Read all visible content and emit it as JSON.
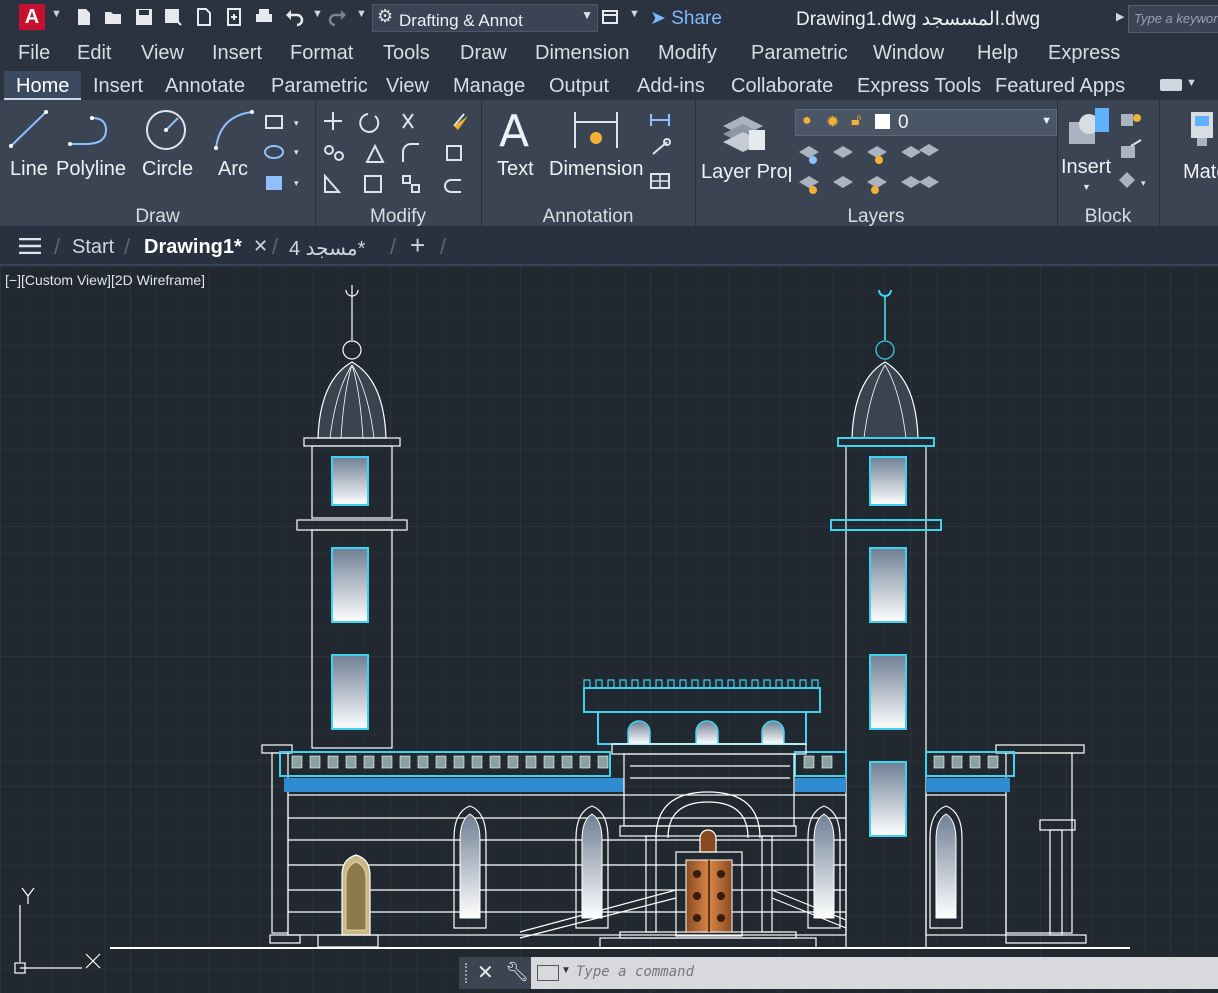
{
  "app": {
    "logo_letter": "A",
    "workspace": "Drafting & Annot",
    "share_label": "Share",
    "title": "Drawing1.dwg المسسجد.dwg",
    "search_placeholder": "Type a keyword"
  },
  "menu": [
    "File",
    "Edit",
    "View",
    "Insert",
    "Format",
    "Tools",
    "Draw",
    "Dimension",
    "Modify",
    "Parametric",
    "Window",
    "Help",
    "Express"
  ],
  "ribbon_tabs": [
    "Home",
    "Insert",
    "Annotate",
    "Parametric",
    "View",
    "Manage",
    "Output",
    "Add-ins",
    "Collaborate",
    "Express Tools",
    "Featured Apps"
  ],
  "ribbon": {
    "draw": {
      "title": "Draw",
      "line": "Line",
      "polyline": "Polyline",
      "circle": "Circle",
      "arc": "Arc"
    },
    "modify": {
      "title": "Modify"
    },
    "annotation": {
      "title": "Annotation",
      "text": "Text",
      "dimension": "Dimension"
    },
    "layers": {
      "title": "Layers",
      "layer_props": "Layer Properties",
      "current_layer": "0"
    },
    "block": {
      "title": "Block",
      "insert": "Insert"
    },
    "match": {
      "label": "Match Properties"
    }
  },
  "file_tabs": {
    "start": "Start",
    "drawing1": "Drawing1*",
    "masjid": "مسجد 4*",
    "new_tab": "+"
  },
  "viewport": {
    "label": "[−][Custom View][2D Wireframe]",
    "ucs_y": "Y"
  },
  "command": {
    "placeholder": "Type a command"
  },
  "colors": {
    "accent": "#7fb8ff",
    "canvas": "#212830",
    "cyan": "#3fd3ef",
    "lines": "#ffffff",
    "logo_red": "#c8102e"
  }
}
